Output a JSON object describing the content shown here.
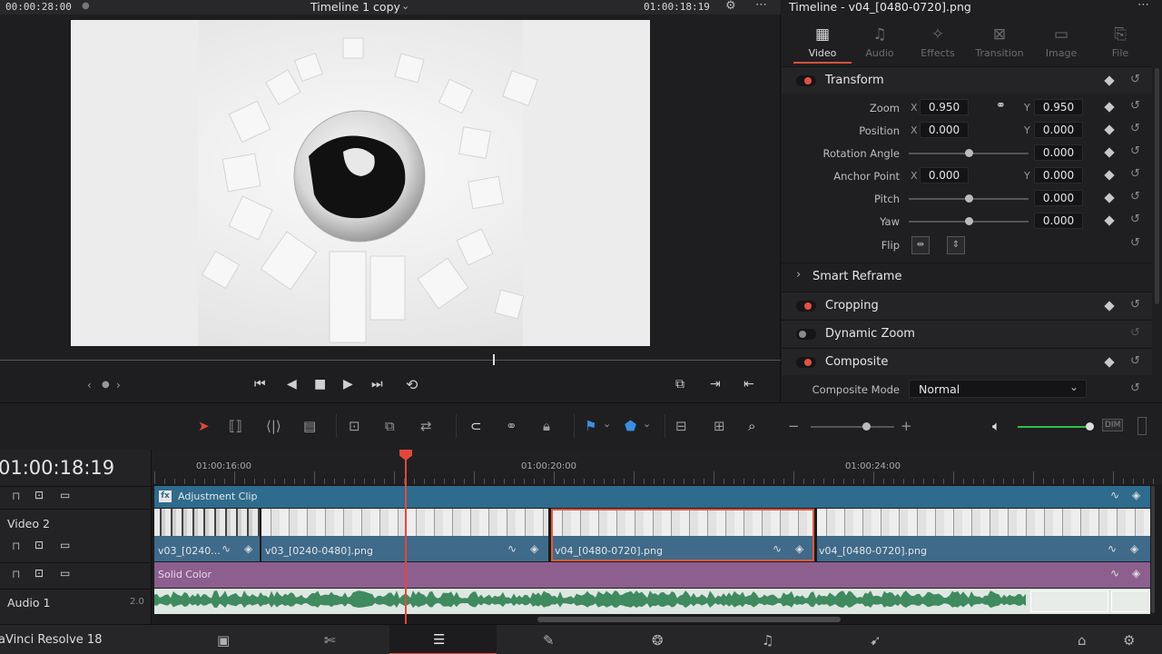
{
  "viewer": {
    "source_timecode": "00:00:28:00",
    "timeline_name": "Timeline 1 copy",
    "record_timecode": "01:00:18:19"
  },
  "inspector": {
    "title": "Timeline - v04_[0480-0720].png",
    "tabs": [
      {
        "label": "Video",
        "icon": "video-icon",
        "active": true
      },
      {
        "label": "Audio",
        "icon": "audio-icon",
        "active": false
      },
      {
        "label": "Effects",
        "icon": "effects-icon",
        "active": false
      },
      {
        "label": "Transition",
        "icon": "transition-icon",
        "active": false
      },
      {
        "label": "Image",
        "icon": "image-icon",
        "active": false
      },
      {
        "label": "File",
        "icon": "file-icon",
        "active": false
      }
    ],
    "transform": {
      "title": "Transform",
      "zoom_label": "Zoom",
      "zoom_x": "0.950",
      "zoom_y": "0.950",
      "position_label": "Position",
      "position_x": "0.000",
      "position_y": "0.000",
      "rotation_label": "Rotation Angle",
      "rotation": "0.000",
      "anchor_label": "Anchor Point",
      "anchor_x": "0.000",
      "anchor_y": "0.000",
      "pitch_label": "Pitch",
      "pitch": "0.000",
      "yaw_label": "Yaw",
      "yaw": "0.000",
      "flip_label": "Flip",
      "axis_x": "X",
      "axis_y": "Y"
    },
    "smart_reframe": "Smart Reframe",
    "cropping": "Cropping",
    "dynamic_zoom": "Dynamic Zoom",
    "composite": {
      "title": "Composite",
      "mode_label": "Composite Mode",
      "mode_value": "Normal"
    }
  },
  "timeline": {
    "timecode": "01:00:18:19",
    "ruler": [
      "01:00:16:00",
      "01:00:20:00",
      "01:00:24:00"
    ],
    "tracks": {
      "adjustment_clip": "Adjustment Clip",
      "video2": "Video 2",
      "solid_color": "Solid Color",
      "audio1": "Audio 1",
      "audio1_channels": "2.0"
    },
    "clips": [
      {
        "label": "v03_[0240..."
      },
      {
        "label": "v03_[0240-0480].png"
      },
      {
        "label": "v04_[0480-0720].png"
      },
      {
        "label": "v04_[0480-0720].png"
      }
    ]
  },
  "app_name": "aVinci Resolve 18",
  "colors": {
    "accent": "#e0483c",
    "adjustment": "#2e6b8c",
    "solid": "#8c5f8f",
    "video": "#3f6a8a",
    "audio": "#3f8a5f"
  }
}
